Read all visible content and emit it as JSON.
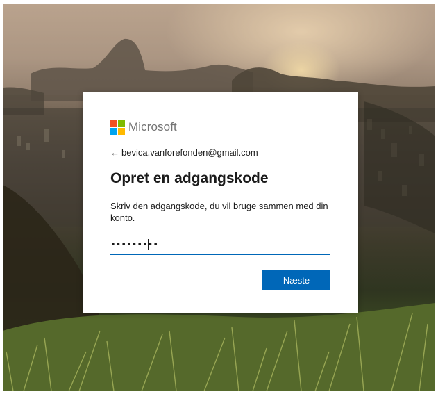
{
  "brand": {
    "name": "Microsoft",
    "logo_colors": [
      "#f25022",
      "#7fba00",
      "#00a4ef",
      "#ffb900"
    ]
  },
  "signin": {
    "back_icon": "back-arrow-icon",
    "back_glyph": "←",
    "identity": "bevica.vanforefonden@gmail.com",
    "title": "Opret en adgangskode",
    "description": "Skriv den adgangskode, du vil bruge sammen med din konto.",
    "password_value": "•••••••••",
    "next_label": "Næste"
  },
  "colors": {
    "accent": "#0067b8",
    "text": "#1b1b1b",
    "brand_text": "#737373"
  }
}
